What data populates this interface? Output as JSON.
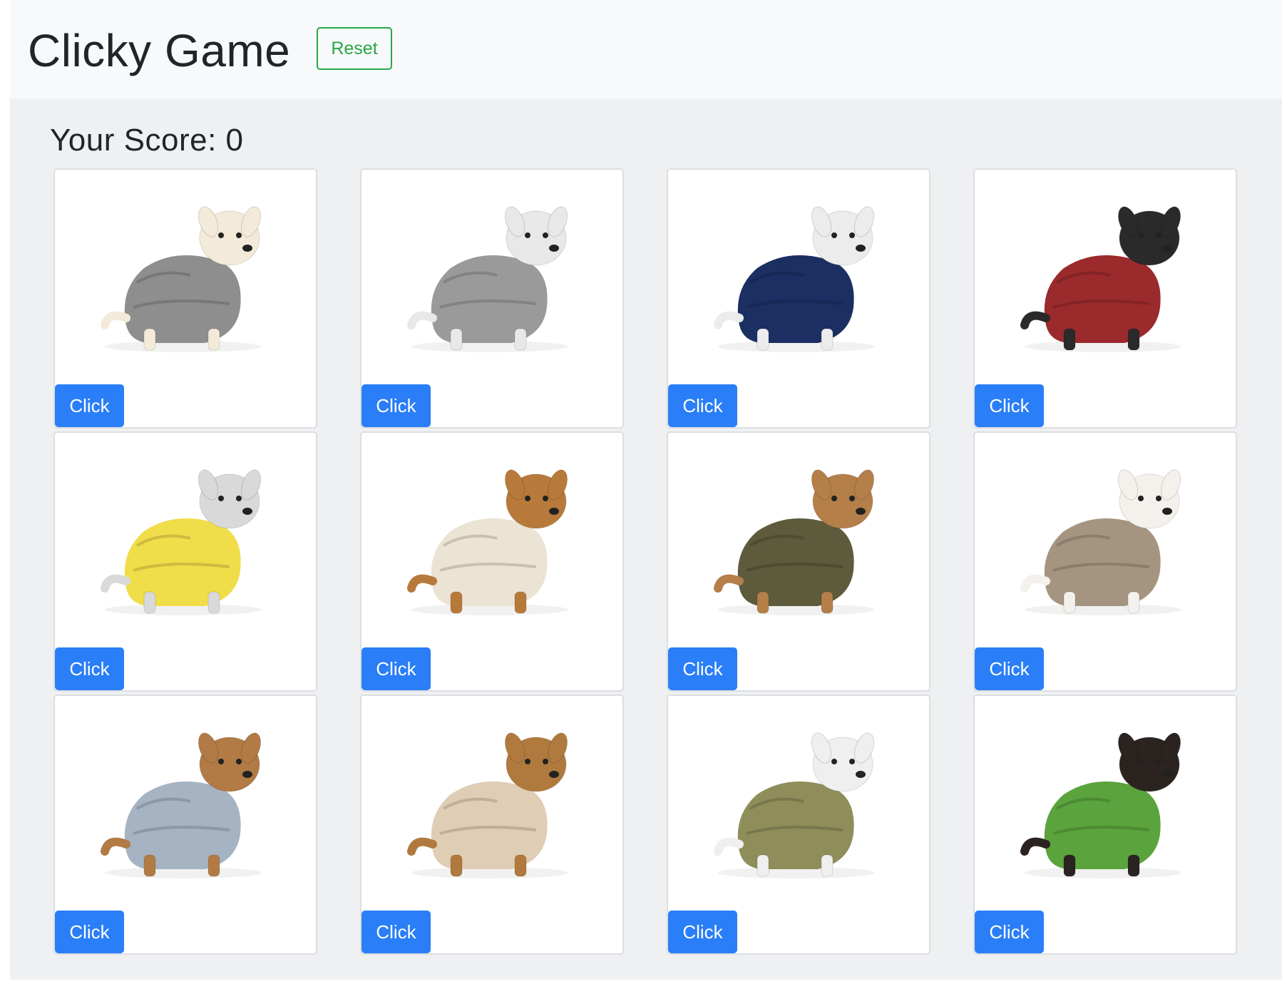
{
  "navbar": {
    "brand": "Clicky Game",
    "reset_label": "Reset"
  },
  "score": {
    "text": "Your Score: 0"
  },
  "cards": [
    {
      "button_label": "Click",
      "icon": "dog-photo",
      "sweater_color": "#8e8e8e",
      "fur_color": "#f3ead9"
    },
    {
      "button_label": "Click",
      "icon": "dog-photo",
      "sweater_color": "#9a9a9a",
      "fur_color": "#e8e8e8"
    },
    {
      "button_label": "Click",
      "icon": "dog-photo",
      "sweater_color": "#1b2f63",
      "fur_color": "#ececec"
    },
    {
      "button_label": "Click",
      "icon": "dog-photo",
      "sweater_color": "#9b2a2c",
      "fur_color": "#2a2a2a"
    },
    {
      "button_label": "Click",
      "icon": "dog-photo",
      "sweater_color": "#f0dd4a",
      "fur_color": "#d9d9d9"
    },
    {
      "button_label": "Click",
      "icon": "dog-photo",
      "sweater_color": "#ebe3d3",
      "fur_color": "#b87a3a"
    },
    {
      "button_label": "Click",
      "icon": "dog-photo",
      "sweater_color": "#5e5a3c",
      "fur_color": "#b47f48"
    },
    {
      "button_label": "Click",
      "icon": "dog-photo",
      "sweater_color": "#a59580",
      "fur_color": "#f4f1ec"
    },
    {
      "button_label": "Click",
      "icon": "dog-photo",
      "sweater_color": "#a5b3c2",
      "fur_color": "#b27a45"
    },
    {
      "button_label": "Click",
      "icon": "dog-photo",
      "sweater_color": "#e0cdb5",
      "fur_color": "#b07a3e"
    },
    {
      "button_label": "Click",
      "icon": "dog-photo",
      "sweater_color": "#8f8e5a",
      "fur_color": "#efefef"
    },
    {
      "button_label": "Click",
      "icon": "dog-photo",
      "sweater_color": "#5aa33d",
      "fur_color": "#2b2320"
    }
  ]
}
